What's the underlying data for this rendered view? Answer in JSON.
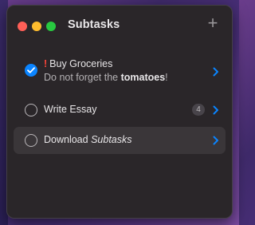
{
  "window": {
    "title": "Subtasks",
    "add_label": "+"
  },
  "tasks": [
    {
      "priority_mark": "!",
      "title": "Buy Groceries",
      "completed": true,
      "note_prefix": "Do not forget the ",
      "note_bold": "tomatoes",
      "note_suffix": "!"
    },
    {
      "title": "Write Essay",
      "completed": false,
      "count": "4"
    },
    {
      "title_prefix": "Download ",
      "title_italic": "Subtasks",
      "completed": false,
      "selected": true
    }
  ],
  "colors": {
    "accent": "#0a84ff",
    "priority": "#ff453a",
    "close": "#ff5f57",
    "minimize": "#febc2e",
    "zoom": "#28c840"
  },
  "icons": {
    "add": "plus-icon",
    "disclosure": "chevron-right-icon",
    "done": "checkmark-icon"
  }
}
